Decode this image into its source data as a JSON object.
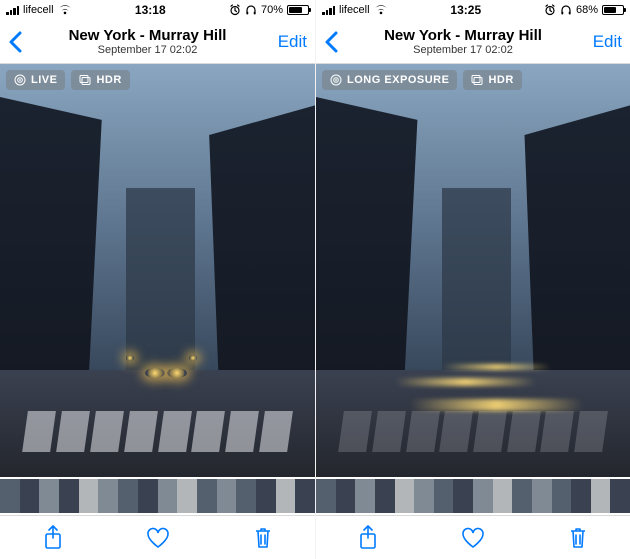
{
  "screens": [
    {
      "status": {
        "carrier": "lifecell",
        "time": "13:18",
        "battery_pct": "70%",
        "battery_fill": 70
      },
      "nav": {
        "title": "New York - Murray Hill",
        "subtitle": "September 17  02:02",
        "edit": "Edit"
      },
      "badges": {
        "primary": "LIVE",
        "primary_icon": "live-icon",
        "secondary": "HDR",
        "secondary_icon": "hdr-icon"
      },
      "photo_style": "normal"
    },
    {
      "status": {
        "carrier": "lifecell",
        "time": "13:25",
        "battery_pct": "68%",
        "battery_fill": 68
      },
      "nav": {
        "title": "New York - Murray Hill",
        "subtitle": "September 17  02:02",
        "edit": "Edit"
      },
      "badges": {
        "primary": "LONG EXPOSURE",
        "primary_icon": "long-exposure-icon",
        "secondary": "HDR",
        "secondary_icon": "hdr-icon"
      },
      "photo_style": "long_exposure"
    }
  ],
  "colors": {
    "tint": "#007aff"
  }
}
